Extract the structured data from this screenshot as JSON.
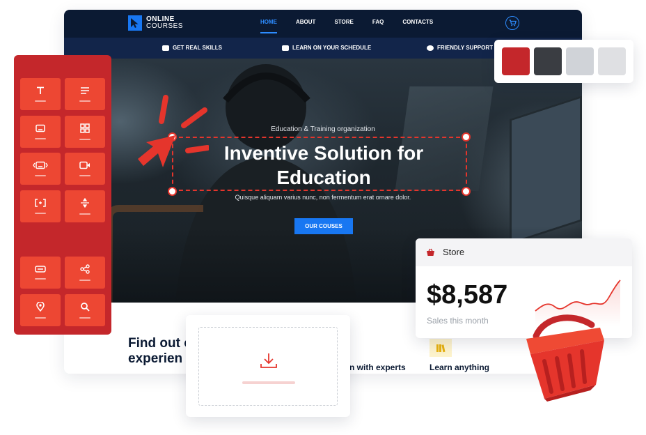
{
  "logo": {
    "line1": "ONLINE",
    "line2": "COURSES"
  },
  "nav": {
    "items": [
      "HOME",
      "ABOUT",
      "STORE",
      "FAQ",
      "CONTACTS"
    ],
    "active": "HOME"
  },
  "features": [
    "GET REAL SKILLS",
    "LEARN ON YOUR SCHEDULE",
    "FRIENDLY SUPPORT"
  ],
  "hero": {
    "subtitle": "Education & Training organization",
    "title": "Inventive Solution for Education",
    "description": "Quisque aliquam varius nunc, non fermentum erat ornare dolor.",
    "button": "OUR COUSES"
  },
  "bottom": {
    "heading": "Find out our co-le experien",
    "col2": "n with experts",
    "col3": "Learn anything"
  },
  "widgets": {
    "items": [
      {
        "icon": "text-icon",
        "glyph": "T"
      },
      {
        "icon": "text-lines-icon",
        "glyph": "≡"
      },
      {
        "icon": "image-icon",
        "glyph": "▭"
      },
      {
        "icon": "grid-icon",
        "glyph": "▦"
      },
      {
        "icon": "slider-icon",
        "glyph": "◂▭▸"
      },
      {
        "icon": "video-icon",
        "glyph": "▶"
      },
      {
        "icon": "spacer-icon",
        "glyph": "[·]"
      },
      {
        "icon": "divider-icon",
        "glyph": "÷"
      },
      {
        "icon": "button-icon",
        "glyph": "▭"
      },
      {
        "icon": "share-icon",
        "glyph": "⋖"
      },
      {
        "icon": "map-pin-icon",
        "glyph": "⌖"
      },
      {
        "icon": "search-icon",
        "glyph": "⌕"
      }
    ]
  },
  "swatches": [
    "#c4272b",
    "#3a3d42",
    "#d0d3d8",
    "#dfe0e3"
  ],
  "store": {
    "title": "Store",
    "amount": "$8,587",
    "caption": "Sales this month"
  },
  "colors": {
    "accent": "#e5352c",
    "brand_blue": "#1877f2",
    "nav_dark": "#0b1a33",
    "panel_red": "#c4272b"
  }
}
